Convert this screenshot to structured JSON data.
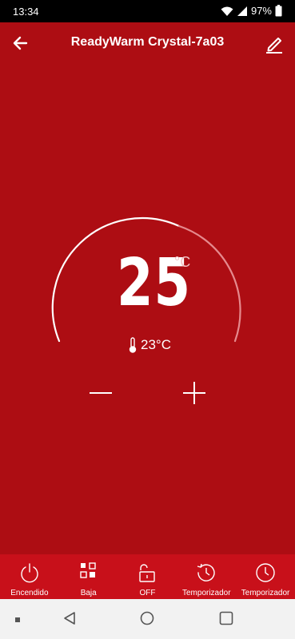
{
  "status": {
    "time": "13:34",
    "battery": "97%"
  },
  "header": {
    "title": "ReadyWarm Crystal-7a03"
  },
  "thermostat": {
    "setpoint": "25",
    "unit": "°C",
    "current": "23°C"
  },
  "bottom_bar": [
    {
      "label": "Encendido"
    },
    {
      "label": "Baja"
    },
    {
      "label": "OFF"
    },
    {
      "label": "Temporizador"
    },
    {
      "label": "Temporizador"
    }
  ],
  "colors": {
    "background": "#ad0d13",
    "bottom_bar": "#c8101a",
    "navbar": "#f2f2f2"
  }
}
